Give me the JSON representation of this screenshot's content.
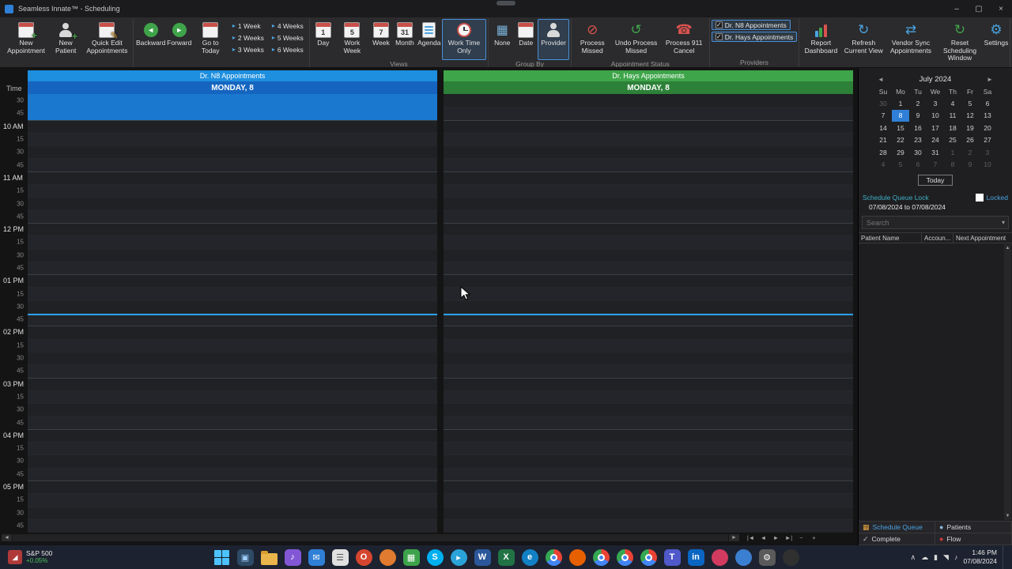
{
  "titlebar": {
    "title": "Seamless Innate™ - Scheduling",
    "controls": [
      {
        "name": "minimize-button",
        "glyph": "–"
      },
      {
        "name": "maximize-button",
        "glyph": "▢"
      },
      {
        "name": "close-button",
        "glyph": "×"
      }
    ]
  },
  "ribbon": {
    "groups": [
      {
        "name": "create",
        "label": "",
        "items": [
          {
            "type": "big",
            "name": "new-appointment-button",
            "label": "New Appointment",
            "icon": {
              "kind": "cal",
              "top": "#c9504a",
              "mark": "+",
              "markColor": "#46a34a"
            }
          },
          {
            "type": "big",
            "name": "new-patient-button",
            "label": "New Patient",
            "icon": {
              "kind": "person",
              "mark": "+",
              "markColor": "#46a34a"
            }
          },
          {
            "type": "big",
            "name": "quick-edit-appointments-button",
            "label": "Quick Edit Appointments",
            "icon": {
              "kind": "cal",
              "top": "#c9504a",
              "mark": "✎",
              "markColor": "#e0a33a"
            }
          }
        ]
      },
      {
        "name": "navigate",
        "label": "",
        "items": [
          {
            "type": "big",
            "name": "backward-button",
            "label": "Backward",
            "icon": {
              "kind": "circle",
              "bg": "#3fa34a",
              "glyph": "◄"
            }
          },
          {
            "type": "big",
            "name": "forward-button",
            "label": "Forward",
            "icon": {
              "kind": "circle",
              "bg": "#3fa34a",
              "glyph": "►"
            }
          },
          {
            "type": "big",
            "name": "go-to-today-button",
            "label": "Go to Today",
            "icon": {
              "kind": "cal",
              "top": "#c9504a",
              "num": ""
            }
          },
          {
            "type": "stack",
            "name": "weeks-stack-1",
            "items": [
              {
                "name": "one-week-button",
                "label": "1 Week",
                "glyph": "▸"
              },
              {
                "name": "two-weeks-button",
                "label": "2 Weeks",
                "glyph": "▸"
              },
              {
                "name": "three-weeks-button",
                "label": "3 Weeks",
                "glyph": "▸"
              }
            ]
          },
          {
            "type": "stack",
            "name": "weeks-stack-2",
            "items": [
              {
                "name": "four-weeks-button",
                "label": "4 Weeks",
                "glyph": "▸"
              },
              {
                "name": "five-weeks-button",
                "label": "5 Weeks",
                "glyph": "▸"
              },
              {
                "name": "six-weeks-button",
                "label": "6 Weeks",
                "glyph": "▸"
              }
            ]
          }
        ]
      },
      {
        "name": "views",
        "label": "Views",
        "items": [
          {
            "type": "big",
            "name": "view-day-button",
            "label": "Day",
            "icon": {
              "kind": "cal",
              "top": "#c9504a",
              "num": "1"
            }
          },
          {
            "type": "big",
            "name": "view-work-week-button",
            "label": "Work Week",
            "icon": {
              "kind": "cal",
              "top": "#c9504a",
              "num": "5"
            }
          },
          {
            "type": "big",
            "name": "view-week-button",
            "label": "Week",
            "icon": {
              "kind": "cal",
              "top": "#c9504a",
              "num": "7"
            }
          },
          {
            "type": "big",
            "name": "view-month-button",
            "label": "Month",
            "icon": {
              "kind": "cal",
              "top": "#c9504a",
              "num": "31"
            }
          },
          {
            "type": "big",
            "name": "view-agenda-button",
            "label": "Agenda",
            "icon": {
              "kind": "agenda"
            }
          },
          {
            "type": "big",
            "name": "work-time-only-button",
            "label": "Work Time Only",
            "selected": true,
            "icon": {
              "kind": "clock"
            }
          }
        ]
      },
      {
        "name": "group-by",
        "label": "Group By",
        "items": [
          {
            "type": "big",
            "name": "group-none-button",
            "label": "None",
            "icon": {
              "kind": "grid"
            }
          },
          {
            "type": "big",
            "name": "group-date-button",
            "label": "Date",
            "icon": {
              "kind": "cal",
              "top": "#c9504a",
              "num": ""
            }
          },
          {
            "type": "big",
            "name": "group-provider-button",
            "label": "Provider",
            "selected": true,
            "icon": {
              "kind": "person"
            }
          }
        ]
      },
      {
        "name": "appointment-status",
        "label": "Appointment Status",
        "items": [
          {
            "type": "big",
            "name": "process-missed-button",
            "label": "Process Missed",
            "icon": {
              "kind": "glyph",
              "glyph": "⊘",
              "color": "#d9534f"
            }
          },
          {
            "type": "big",
            "name": "undo-process-missed-button",
            "label": "Undo Process Missed",
            "icon": {
              "kind": "glyph",
              "glyph": "↺",
              "color": "#3fa34a"
            }
          },
          {
            "type": "big",
            "name": "process-911-cancel-button",
            "label": "Process 911 Cancel",
            "icon": {
              "kind": "glyph",
              "glyph": "☎",
              "color": "#d9534f"
            }
          }
        ]
      },
      {
        "name": "providers",
        "label": "Providers",
        "items": [
          {
            "type": "check",
            "name": "provider-n8-checkbox",
            "label": "Dr. N8 Appointments",
            "checked": true
          },
          {
            "type": "check",
            "name": "provider-hays-checkbox",
            "label": "Dr. Hays Appointments",
            "checked": true
          }
        ]
      },
      {
        "name": "tools",
        "label": "",
        "items": [
          {
            "type": "big",
            "name": "report-dashboard-button",
            "label": "Report Dashboard",
            "icon": {
              "kind": "bars"
            }
          },
          {
            "type": "big",
            "name": "refresh-current-view-button",
            "label": "Refresh Current View",
            "icon": {
              "kind": "glyph",
              "glyph": "↻",
              "color": "#4aa3e0"
            }
          },
          {
            "type": "big",
            "name": "vendor-sync-appointments-button",
            "label": "Vendor Sync Appointments",
            "icon": {
              "kind": "glyph",
              "glyph": "⇄",
              "color": "#4aa3e0"
            }
          },
          {
            "type": "big",
            "name": "reset-scheduling-window-button",
            "label": "Reset Scheduling Window",
            "icon": {
              "kind": "glyph",
              "glyph": "↻",
              "color": "#3fa34a"
            }
          },
          {
            "type": "big",
            "name": "settings-button",
            "label": "Settings",
            "icon": {
              "kind": "glyph",
              "glyph": "⚙",
              "color": "#4aa3e0"
            }
          }
        ]
      }
    ]
  },
  "schedule": {
    "time_header": "Time",
    "start_time_minutes": 570,
    "slot_minutes": 15,
    "current_time_minutes": 826,
    "time_slots": [
      "30",
      "45",
      "10 AM",
      "15",
      "30",
      "45",
      "11 AM",
      "15",
      "30",
      "45",
      "12 PM",
      "15",
      "30",
      "45",
      "01 PM",
      "15",
      "30",
      "45",
      "02 PM",
      "15",
      "30",
      "45",
      "03 PM",
      "15",
      "30",
      "45",
      "04 PM",
      "15",
      "30",
      "45",
      "05 PM",
      "15",
      "30",
      "45"
    ],
    "columns": [
      {
        "name": "dr-n8",
        "title": "Dr. N8 Appointments",
        "day": "MONDAY, 8",
        "header_color": "#1e8ede",
        "day_color": "#1565c0",
        "selection": {
          "start_row": 0,
          "rows": 2,
          "color": "#1a78cf"
        }
      },
      {
        "name": "dr-hays",
        "title": "Dr. Hays Appointments",
        "day": "MONDAY, 8",
        "header_color": "#3fa54a",
        "day_color": "#2d8038"
      }
    ],
    "bottom_nav": {
      "scroll_left": "◄",
      "scroll_right": "►",
      "buttons": [
        {
          "name": "page-first-button",
          "glyph": "|◄"
        },
        {
          "name": "page-prev-button",
          "glyph": "◄"
        },
        {
          "name": "page-next-button",
          "glyph": "►"
        },
        {
          "name": "page-last-button",
          "glyph": "►|"
        },
        {
          "name": "zoom-out-button",
          "glyph": "−"
        },
        {
          "name": "zoom-in-button",
          "glyph": "+"
        }
      ]
    }
  },
  "right_panel": {
    "mini_calendar": {
      "prev_glyph": "◄",
      "next_glyph": "►",
      "month_label": "July 2024",
      "day_headers": [
        "Su",
        "Mo",
        "Tu",
        "We",
        "Th",
        "Fr",
        "Sa"
      ],
      "weeks": [
        [
          {
            "d": "30",
            "muted": true
          },
          {
            "d": "1"
          },
          {
            "d": "2"
          },
          {
            "d": "3"
          },
          {
            "d": "4"
          },
          {
            "d": "5"
          },
          {
            "d": "6"
          }
        ],
        [
          {
            "d": "7"
          },
          {
            "d": "8",
            "selected": true
          },
          {
            "d": "9"
          },
          {
            "d": "10"
          },
          {
            "d": "11"
          },
          {
            "d": "12"
          },
          {
            "d": "13"
          }
        ],
        [
          {
            "d": "14"
          },
          {
            "d": "15"
          },
          {
            "d": "16"
          },
          {
            "d": "17"
          },
          {
            "d": "18"
          },
          {
            "d": "19"
          },
          {
            "d": "20"
          }
        ],
        [
          {
            "d": "21"
          },
          {
            "d": "22"
          },
          {
            "d": "23"
          },
          {
            "d": "24"
          },
          {
            "d": "25"
          },
          {
            "d": "26"
          },
          {
            "d": "27"
          }
        ],
        [
          {
            "d": "28"
          },
          {
            "d": "29"
          },
          {
            "d": "30"
          },
          {
            "d": "31"
          },
          {
            "d": "1",
            "muted": true
          },
          {
            "d": "2",
            "muted": true
          },
          {
            "d": "3",
            "muted": true
          }
        ],
        [
          {
            "d": "4",
            "muted": true
          },
          {
            "d": "5",
            "muted": true
          },
          {
            "d": "6",
            "muted": true
          },
          {
            "d": "7",
            "muted": true
          },
          {
            "d": "8",
            "muted": true
          },
          {
            "d": "9",
            "muted": true
          },
          {
            "d": "10",
            "muted": true
          }
        ]
      ],
      "today_label": "Today"
    },
    "queue_lock": {
      "title": "Schedule Queue Lock",
      "locked_label": "Locked",
      "range": "07/08/2024 to 07/08/2024"
    },
    "search_placeholder": "Search",
    "patient_table": {
      "columns": [
        "Patient Name",
        "Accoun...",
        "Next Appointment"
      ]
    },
    "tabs": [
      {
        "name": "tab-schedule-queue",
        "label": "Schedule Queue",
        "active": true,
        "glyph": "▦",
        "icon_color": "#e8a33d"
      },
      {
        "name": "tab-patients",
        "label": "Patients",
        "active": false,
        "glyph": "●",
        "icon_color": "#8ab4d8"
      },
      {
        "name": "tab-complete",
        "label": "Complete",
        "active": false,
        "glyph": "✓",
        "icon_color": "#b8b8b8"
      },
      {
        "name": "tab-flow",
        "label": "Flow",
        "active": false,
        "glyph": "●",
        "icon_color": "#d23b3b"
      }
    ]
  },
  "taskbar": {
    "widget": {
      "name": "S&P 500",
      "change": "+0.05%",
      "icon_glyph": "◢"
    },
    "icons": [
      {
        "name": "start-button",
        "kind": "win"
      },
      {
        "name": "task-view-button",
        "kind": "square",
        "bg": "#2d4a66",
        "glyph": "▣",
        "fg": "#9fd0ff"
      },
      {
        "name": "file-explorer",
        "kind": "folder"
      },
      {
        "name": "media-player-app",
        "kind": "square",
        "bg": "#8257d6",
        "glyph": "♪"
      },
      {
        "name": "mail-app",
        "kind": "square",
        "bg": "#2f7fd6",
        "glyph": "✉"
      },
      {
        "name": "notepad-app",
        "kind": "square",
        "bg": "#e0e0e0",
        "glyph": "☰",
        "fg": "#555555"
      },
      {
        "name": "browser-opera",
        "kind": "circle",
        "bg": "#d6452f",
        "glyph": "O"
      },
      {
        "name": "app-orange",
        "kind": "circle",
        "bg": "#e07b2f",
        "glyph": ""
      },
      {
        "name": "calendar-app",
        "kind": "square",
        "bg": "#3da34a",
        "glyph": "▦"
      },
      {
        "name": "skype-app",
        "kind": "circle",
        "bg": "#00aff0",
        "glyph": "S"
      },
      {
        "name": "telegram-app",
        "kind": "circle",
        "bg": "#2aa3d8",
        "glyph": "▸"
      },
      {
        "name": "word-app",
        "kind": "square",
        "bg": "#2b579a",
        "glyph": "W"
      },
      {
        "name": "excel-app",
        "kind": "square",
        "bg": "#217346",
        "glyph": "X"
      },
      {
        "name": "edge-browser",
        "kind": "circle",
        "bg": "#1280c4",
        "glyph": "e"
      },
      {
        "name": "chrome-browser",
        "kind": "chrome"
      },
      {
        "name": "firefox-browser",
        "kind": "circle",
        "bg": "#e66000",
        "glyph": ""
      },
      {
        "name": "chrome-beta-browser",
        "kind": "chrome"
      },
      {
        "name": "chrome-dev-browser",
        "kind": "chrome"
      },
      {
        "name": "chrome-canary-browser",
        "kind": "chrome"
      },
      {
        "name": "teams-app",
        "kind": "square",
        "bg": "#5059c9",
        "glyph": "T"
      },
      {
        "name": "linkedin-app",
        "kind": "square",
        "bg": "#0a66c2",
        "glyph": "in"
      },
      {
        "name": "app-red",
        "kind": "circle",
        "bg": "#d23b5f",
        "glyph": ""
      },
      {
        "name": "app-blue",
        "kind": "circle",
        "bg": "#3b7fd2",
        "glyph": ""
      },
      {
        "name": "settings-app",
        "kind": "square",
        "bg": "#5a5a5a",
        "glyph": "⚙"
      },
      {
        "name": "app-dark",
        "kind": "circle",
        "bg": "#303030",
        "glyph": ""
      }
    ],
    "tray": {
      "icons": [
        {
          "name": "tray-chevron-icon",
          "glyph": "∧"
        },
        {
          "name": "cloud-icon",
          "glyph": "☁"
        },
        {
          "name": "battery-icon",
          "glyph": "▮"
        },
        {
          "name": "wifi-icon",
          "glyph": "◥"
        },
        {
          "name": "volume-icon",
          "glyph": "♪"
        }
      ],
      "time": "1:46 PM",
      "date": "07/08/2024"
    }
  }
}
